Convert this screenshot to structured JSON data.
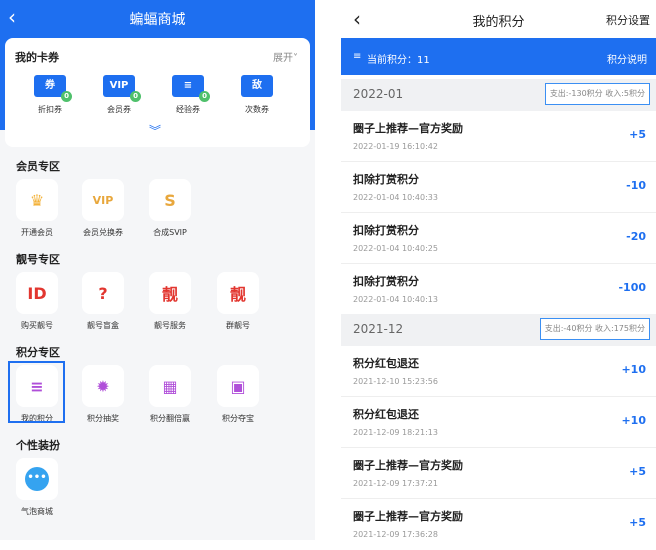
{
  "left": {
    "title": "蝙蝠商城",
    "back_icon": "chevron-left-icon",
    "coupon_card": {
      "title": "我的卡券",
      "expand": "展开",
      "items": [
        {
          "icon_text": "券",
          "badge": "0",
          "label": "折扣券"
        },
        {
          "icon_text": "VIP",
          "badge": "0",
          "label": "会员券"
        },
        {
          "icon_text": "≡",
          "badge": "0",
          "label": "经验券"
        },
        {
          "icon_text": "敌",
          "badge": "",
          "label": "次数券"
        }
      ]
    },
    "sections": [
      {
        "title": "会员专区",
        "items": [
          {
            "glyph": "♛",
            "label": "开通会员"
          },
          {
            "glyph": "VIP",
            "label": "会员兑换券"
          },
          {
            "glyph": "S",
            "label": "合成SVIP"
          }
        ]
      },
      {
        "title": "靓号专区",
        "items": [
          {
            "glyph": "ID",
            "label": "购买靓号"
          },
          {
            "glyph": "?",
            "label": "靓号盲盒"
          },
          {
            "glyph": "靓",
            "label": "靓号服务"
          },
          {
            "glyph": "靓",
            "label": "群靓号"
          }
        ]
      },
      {
        "title": "积分专区",
        "items": [
          {
            "glyph": "≡",
            "label": "我的积分"
          },
          {
            "glyph": "✹",
            "label": "积分抽奖"
          },
          {
            "glyph": "▦",
            "label": "积分翻倍赢"
          },
          {
            "glyph": "▣",
            "label": "积分夺宝"
          }
        ]
      },
      {
        "title": "个性装扮",
        "items": [
          {
            "glyph": "•••",
            "label": "气泡商城"
          }
        ]
      }
    ]
  },
  "right": {
    "title": "我的积分",
    "settings": "积分设置",
    "current_points": "当前积分：11",
    "explain": "积分说明",
    "months": [
      {
        "label": "2022-01",
        "stat": "支出:-130积分 收入:5积分",
        "items": [
          {
            "title": "圈子上推荐—官方奖励",
            "time": "2022-01-19 16:10:42",
            "value": "+5"
          },
          {
            "title": "扣除打赏积分",
            "time": "2022-01-04 10:40:33",
            "value": "-10"
          },
          {
            "title": "扣除打赏积分",
            "time": "2022-01-04 10:40:25",
            "value": "-20"
          },
          {
            "title": "扣除打赏积分",
            "time": "2022-01-04 10:40:13",
            "value": "-100"
          }
        ]
      },
      {
        "label": "2021-12",
        "stat": "支出:-40积分 收入:175积分",
        "items": [
          {
            "title": "积分红包退还",
            "time": "2021-12-10 15:23:56",
            "value": "+10"
          },
          {
            "title": "积分红包退还",
            "time": "2021-12-09 18:21:13",
            "value": "+10"
          },
          {
            "title": "圈子上推荐—官方奖励",
            "time": "2021-12-09 17:37:21",
            "value": "+5"
          },
          {
            "title": "圈子上推荐—官方奖励",
            "time": "2021-12-09 17:36:28",
            "value": "+5"
          }
        ]
      }
    ]
  }
}
